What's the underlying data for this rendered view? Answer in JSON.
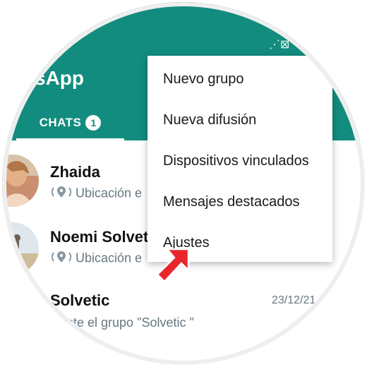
{
  "statusbar": {
    "left_icons": "@ •",
    "right_icons": "⋰⊠"
  },
  "app": {
    "title": "sApp",
    "accent": "#128c7e"
  },
  "tabs": [
    {
      "label": "CHATS",
      "badge": "1",
      "selected": true
    }
  ],
  "chats": [
    {
      "name": "Zhaida",
      "preview": "Ubicación e",
      "time": "",
      "icon": "location-pin-icon"
    },
    {
      "name": "Noemi Solvet",
      "preview": "Ubicación e",
      "time": "",
      "icon": "location-pin-icon"
    },
    {
      "name": "Solvetic",
      "preview": "aste el grupo \"Solvetic \"",
      "time": "23/12/21",
      "icon": ""
    }
  ],
  "menu": {
    "items": [
      {
        "label": "Nuevo grupo"
      },
      {
        "label": "Nueva difusión"
      },
      {
        "label": "Dispositivos vinculados"
      },
      {
        "label": "Mensajes destacados"
      },
      {
        "label": "Ajustes"
      }
    ]
  },
  "annotation": {
    "arrow_color": "#e8262b",
    "icon": "red-arrow-pointer-icon"
  }
}
